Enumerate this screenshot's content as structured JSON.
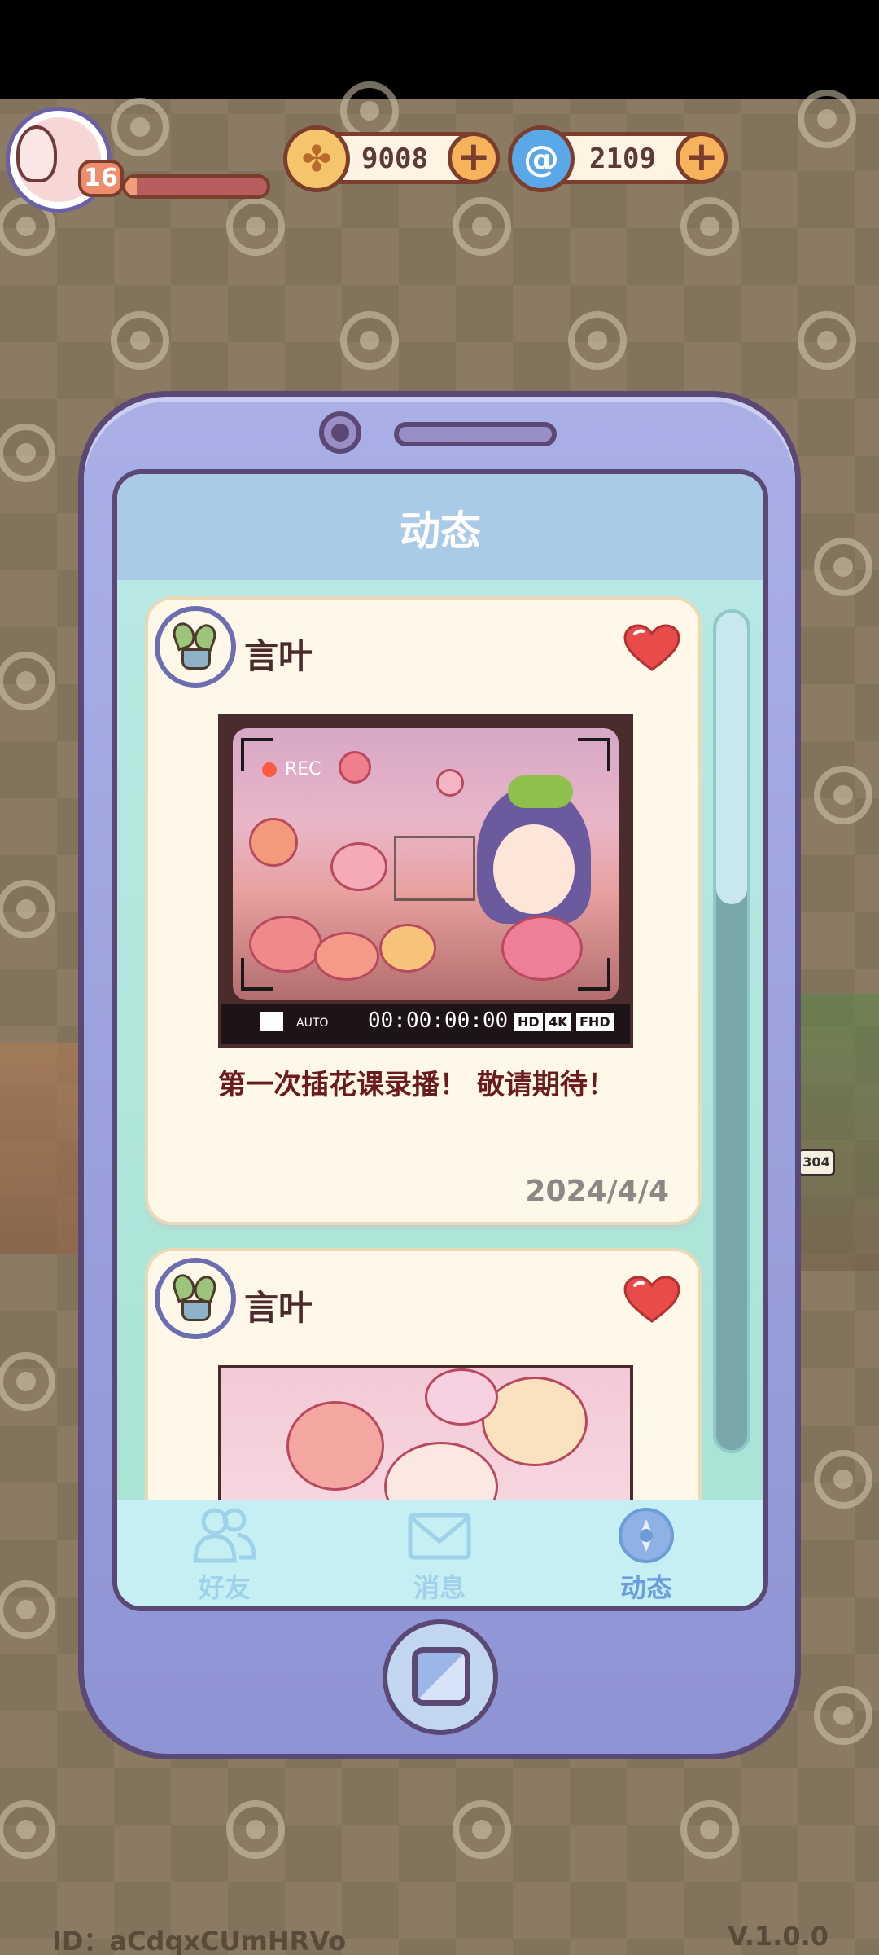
{
  "hud": {
    "level": "16",
    "xp_fraction": 0.08,
    "coins": "9008",
    "gems": "2109",
    "colors": {
      "coin": "#f6c46b",
      "gem": "#5aa8e8",
      "plus": "#f6b35b"
    }
  },
  "phone": {
    "title": "动态",
    "posts": [
      {
        "author": "言叶",
        "liked": true,
        "photo": {
          "rec_label": "REC",
          "auto_label": "AUTO",
          "timecode": "00:00:00:00",
          "badges": [
            "HD",
            "4K",
            "FHD"
          ]
        },
        "text": "第一次插花课录播！ 敬请期待！",
        "date": "2024/4/4"
      },
      {
        "author": "言叶",
        "liked": true
      }
    ],
    "nav": [
      {
        "label": "好友",
        "icon": "friends-icon",
        "active": false
      },
      {
        "label": "消息",
        "icon": "mail-icon",
        "active": false
      },
      {
        "label": "动态",
        "icon": "moments-icon",
        "active": true
      }
    ]
  },
  "scenery": {
    "sign": "304"
  },
  "footer": {
    "id": "ID：aCdqxCUmHRVo",
    "version": "V.1.0.0"
  }
}
